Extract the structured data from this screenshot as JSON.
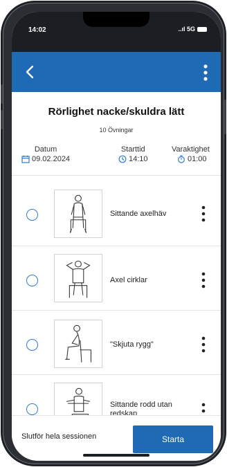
{
  "status": {
    "time": "14:02",
    "signal": "..ıl 5G"
  },
  "session": {
    "title": "Rörlighet nacke/skuldra lätt",
    "count": "10 Övningar"
  },
  "meta": {
    "date_label": "Datum",
    "date_value": "09.02.2024",
    "start_label": "Starttid",
    "start_value": "14:10",
    "duration_label": "Varaktighet",
    "duration_value": "01:00"
  },
  "exercises": [
    {
      "name": "Sittande axelhäv"
    },
    {
      "name": "Axel cirklar"
    },
    {
      "name": "\"Skjuta rygg\""
    },
    {
      "name": "Sittande rodd utan redskap"
    }
  ],
  "footer": {
    "finish_label": "Slutför hela sessionen",
    "start_label": "Starta"
  },
  "colors": {
    "primary": "#1f6ab4",
    "radio": "#2c7ad6"
  },
  "icons": [
    "back-icon",
    "more-vert-icon",
    "calendar-icon",
    "clock-icon",
    "timer-icon"
  ]
}
